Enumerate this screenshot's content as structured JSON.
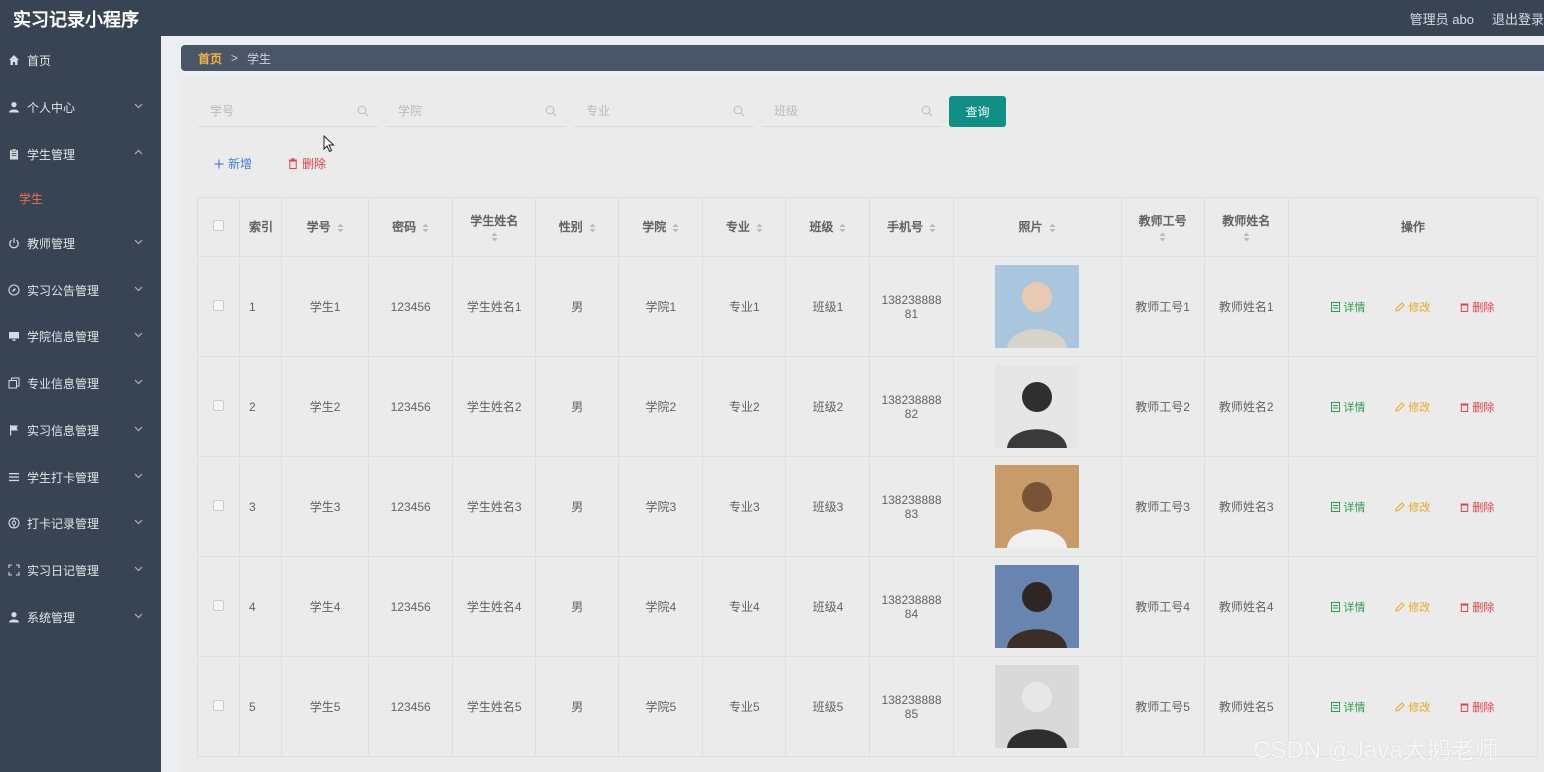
{
  "app": {
    "title": "实习记录小程序"
  },
  "header": {
    "user_label": "管理员 abo",
    "logout_label": "退出登录"
  },
  "sidebar": {
    "items": [
      {
        "label": "首页",
        "icon": "home-icon"
      },
      {
        "label": "个人中心",
        "icon": "user-icon"
      },
      {
        "label": "学生管理",
        "icon": "clipboard-icon"
      },
      {
        "label": "学生",
        "icon": ""
      },
      {
        "label": "教师管理",
        "icon": "power-icon"
      },
      {
        "label": "实习公告管理",
        "icon": "compass-icon"
      },
      {
        "label": "学院信息管理",
        "icon": "monitor-icon"
      },
      {
        "label": "专业信息管理",
        "icon": "copy-icon"
      },
      {
        "label": "实习信息管理",
        "icon": "flag-icon"
      },
      {
        "label": "学生打卡管理",
        "icon": "list-icon"
      },
      {
        "label": "打卡记录管理",
        "icon": "aperture-icon"
      },
      {
        "label": "实习日记管理",
        "icon": "frame-icon"
      },
      {
        "label": "系统管理",
        "icon": "user-icon"
      }
    ]
  },
  "breadcrumb": {
    "home": "首页",
    "separator": ">",
    "current": "学生"
  },
  "search": {
    "student_no_placeholder": "学号",
    "college_placeholder": "学院",
    "major_placeholder": "专业",
    "class_placeholder": "班级",
    "query_label": "查询"
  },
  "actions": {
    "add_label": "新增",
    "delete_label": "删除"
  },
  "table": {
    "columns": [
      "索引",
      "学号",
      "密码",
      "学生姓名",
      "性别",
      "学院",
      "专业",
      "班级",
      "手机号",
      "照片",
      "教师工号",
      "教师姓名",
      "操作"
    ],
    "rows": [
      {
        "index": "1",
        "student_no": "学生1",
        "password": "123456",
        "name": "学生姓名1",
        "gender": "男",
        "college": "学院1",
        "major": "专业1",
        "class": "班级1",
        "phone_a": "138238888",
        "phone_b": "81",
        "teacher_no": "教师工号1",
        "teacher_name": "教师姓名1"
      },
      {
        "index": "2",
        "student_no": "学生2",
        "password": "123456",
        "name": "学生姓名2",
        "gender": "男",
        "college": "学院2",
        "major": "专业2",
        "class": "班级2",
        "phone_a": "138238888",
        "phone_b": "82",
        "teacher_no": "教师工号2",
        "teacher_name": "教师姓名2"
      },
      {
        "index": "3",
        "student_no": "学生3",
        "password": "123456",
        "name": "学生姓名3",
        "gender": "男",
        "college": "学院3",
        "major": "专业3",
        "class": "班级3",
        "phone_a": "138238888",
        "phone_b": "83",
        "teacher_no": "教师工号3",
        "teacher_name": "教师姓名3"
      },
      {
        "index": "4",
        "student_no": "学生4",
        "password": "123456",
        "name": "学生姓名4",
        "gender": "男",
        "college": "学院4",
        "major": "专业4",
        "class": "班级4",
        "phone_a": "138238888",
        "phone_b": "84",
        "teacher_no": "教师工号4",
        "teacher_name": "教师姓名4"
      },
      {
        "index": "5",
        "student_no": "学生5",
        "password": "123456",
        "name": "学生姓名5",
        "gender": "男",
        "college": "学院5",
        "major": "专业5",
        "class": "班级5",
        "phone_a": "138238888",
        "phone_b": "85",
        "teacher_no": "教师工号5",
        "teacher_name": "教师姓名5"
      }
    ],
    "ops": {
      "detail": "详情",
      "edit": "修改",
      "delete": "删除"
    }
  },
  "watermark": "CSDN @Java大鹅老师",
  "colors": {
    "sidebar_bg": "#384454",
    "active_sub": "#f17051",
    "breadcrumb_home": "#f5b544",
    "query_button": "#0f8f86",
    "add_link": "#3a7fd5",
    "delete_link": "#e0424c",
    "detail_op": "#2e9a4e",
    "edit_op": "#e9a81e"
  }
}
